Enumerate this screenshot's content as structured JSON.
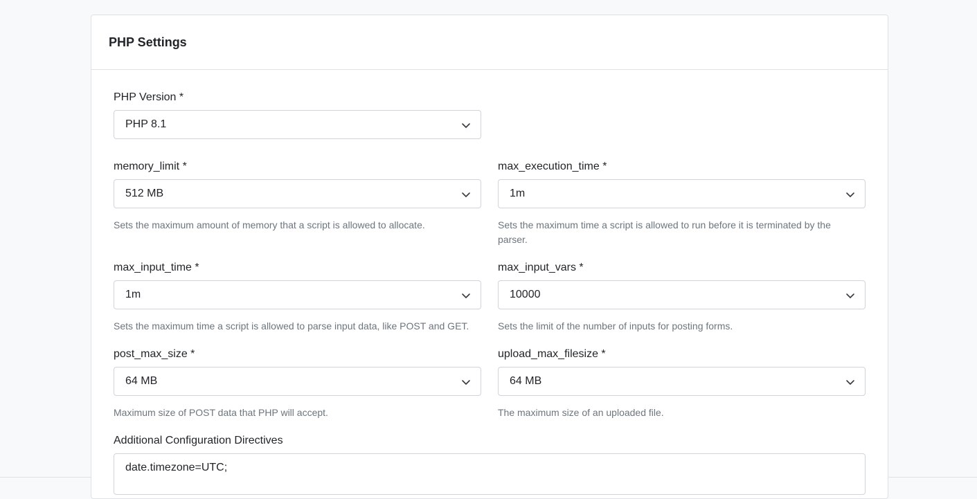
{
  "card": {
    "title": "PHP Settings"
  },
  "php_version": {
    "label": "PHP Version *",
    "value": "PHP 8.1"
  },
  "memory_limit": {
    "label": "memory_limit *",
    "value": "512 MB",
    "help": "Sets the maximum amount of memory that a script is allowed to allocate."
  },
  "max_execution_time": {
    "label": "max_execution_time *",
    "value": "1m",
    "help": "Sets the maximum time a script is allowed to run before it is terminated by the parser."
  },
  "max_input_time": {
    "label": "max_input_time *",
    "value": "1m",
    "help": "Sets the maximum time a script is allowed to parse input data, like POST and GET."
  },
  "max_input_vars": {
    "label": "max_input_vars *",
    "value": "10000",
    "help": "Sets the limit of the number of inputs for posting forms."
  },
  "post_max_size": {
    "label": "post_max_size *",
    "value": "64 MB",
    "help": "Maximum size of POST data that PHP will accept."
  },
  "upload_max_filesize": {
    "label": "upload_max_filesize *",
    "value": "64 MB",
    "help": "The maximum size of an uploaded file."
  },
  "additional_directives": {
    "label": "Additional Configuration Directives",
    "value": "date.timezone=UTC;"
  },
  "icons": {
    "select_arrow": "chevron-down-icon"
  }
}
